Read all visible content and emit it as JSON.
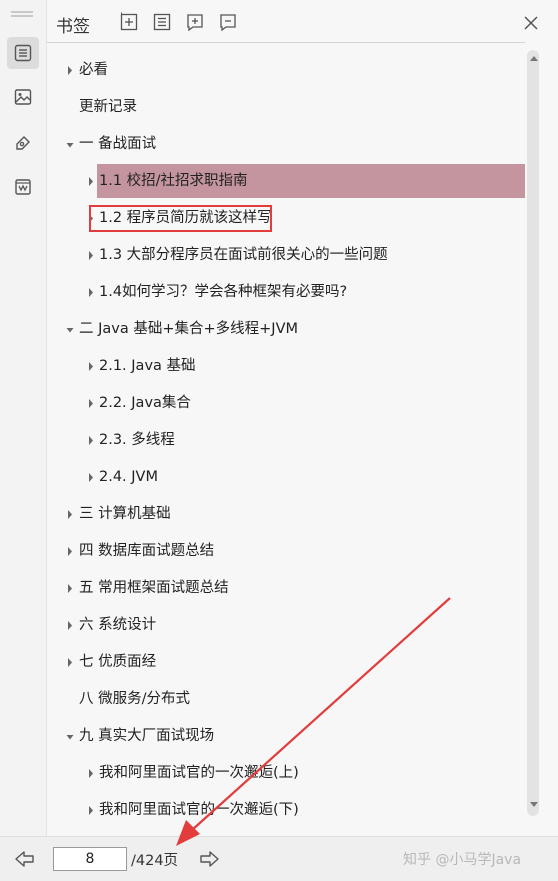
{
  "panel": {
    "title": "书签",
    "tools": [
      "expand-all-icon",
      "collapse-all-icon",
      "add-bookmark-icon",
      "remove-bookmark-icon"
    ]
  },
  "rail": [
    "bookmark-list-icon",
    "thumbnail-icon",
    "annotation-icon",
    "attachment-icon"
  ],
  "tree": [
    {
      "label": "必看",
      "level": 0,
      "arrow": "right"
    },
    {
      "label": "更新记录",
      "level": 0,
      "arrow": "none"
    },
    {
      "label": "一 备战面试",
      "level": 0,
      "arrow": "down"
    },
    {
      "label": "1.1 校招/社招求职指南",
      "level": 1,
      "arrow": "right",
      "selected": true
    },
    {
      "label": "1.2 程序员简历就该这样写",
      "level": 1,
      "arrow": "right",
      "highlighted": true
    },
    {
      "label": "1.3 大部分程序员在面试前很关心的一些问题",
      "level": 1,
      "arrow": "right"
    },
    {
      "label": "1.4如何学习？学会各种框架有必要吗?",
      "level": 1,
      "arrow": "right"
    },
    {
      "label": "二 Java 基础+集合+多线程+JVM",
      "level": 0,
      "arrow": "down"
    },
    {
      "label": "2.1. Java 基础",
      "level": 1,
      "arrow": "right"
    },
    {
      "label": "2.2. Java集合",
      "level": 1,
      "arrow": "right"
    },
    {
      "label": "2.3. 多线程",
      "level": 1,
      "arrow": "right"
    },
    {
      "label": "2.4. JVM",
      "level": 1,
      "arrow": "right"
    },
    {
      "label": "三 计算机基础",
      "level": 0,
      "arrow": "right"
    },
    {
      "label": "四 数据库面试题总结",
      "level": 0,
      "arrow": "right"
    },
    {
      "label": "五 常用框架面试题总结",
      "level": 0,
      "arrow": "right"
    },
    {
      "label": "六 系统设计",
      "level": 0,
      "arrow": "right"
    },
    {
      "label": "七 优质面经",
      "level": 0,
      "arrow": "right"
    },
    {
      "label": "八 微服务/分布式",
      "level": 0,
      "arrow": "none"
    },
    {
      "label": "九 真实大厂面试现场",
      "level": 0,
      "arrow": "down"
    },
    {
      "label": "我和阿里面试官的一次邂逅(上)",
      "level": 1,
      "arrow": "right"
    },
    {
      "label": "我和阿里面试官的一次邂逅(下)",
      "level": 1,
      "arrow": "right"
    }
  ],
  "footer": {
    "page_value": "8",
    "page_total": "/424页",
    "watermark": "知乎 @小马学Java"
  },
  "colors": {
    "selected_row": "#c4959f",
    "highlight_box": "#e23c3c",
    "annotation_arrow": "#e23c3c"
  }
}
